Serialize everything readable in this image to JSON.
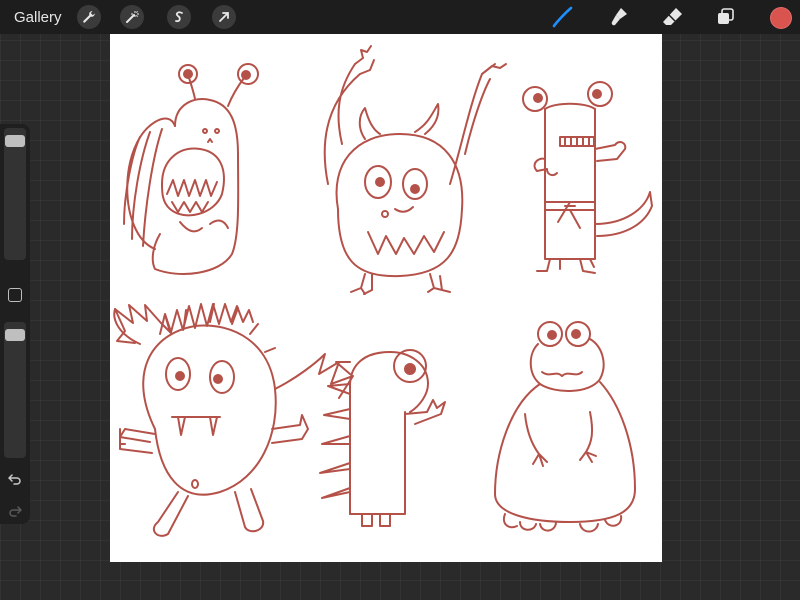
{
  "toolbar": {
    "gallery_label": "Gallery",
    "left_tools": [
      "wrench-icon",
      "magic-wand-icon",
      "selection-icon",
      "transform-arrow-icon"
    ],
    "right_tools": [
      "brush-icon",
      "smudge-icon",
      "eraser-icon",
      "layers-icon"
    ],
    "active_tool": "brush",
    "current_color": "#d9534f"
  },
  "sidebar": {
    "brush_size_level": 0.96,
    "opacity_level": 0.96
  },
  "canvas": {
    "stroke_color": "#b4524a",
    "background": "#ffffff"
  }
}
